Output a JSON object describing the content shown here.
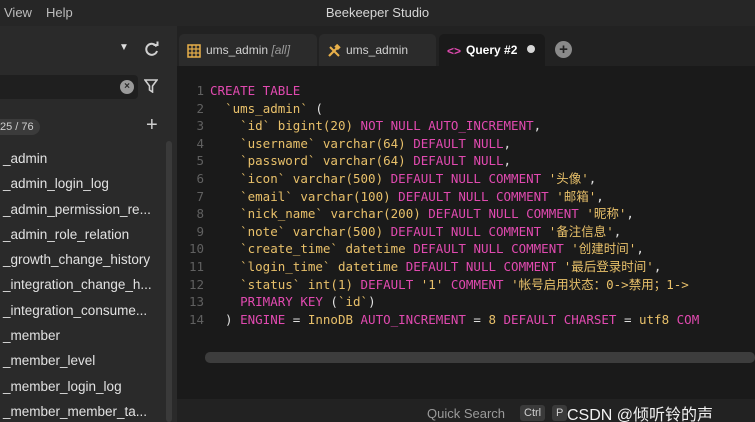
{
  "app": {
    "title": "Beekeeper Studio",
    "menu": [
      "View",
      "Help"
    ]
  },
  "sidebar": {
    "search": {
      "value": "",
      "placeholder": ""
    },
    "count": "25 / 76",
    "tables": [
      "_admin",
      "_admin_login_log",
      "_admin_permission_re...",
      "_admin_role_relation",
      "_growth_change_history",
      "_integration_change_h...",
      "_integration_consume...",
      "_member",
      "_member_level",
      "_member_login_log",
      "_member_member_ta..."
    ]
  },
  "tabs": [
    {
      "label": "ums_admin",
      "suffix": "[all]",
      "icon": "table-icon"
    },
    {
      "label": "ums_admin",
      "icon": "tools-icon"
    },
    {
      "label": "Query #2",
      "icon": "code-icon",
      "active": true
    }
  ],
  "editor": {
    "lines": [
      {
        "n": "1",
        "tokens": [
          [
            "kw",
            "CREATE TABLE"
          ]
        ]
      },
      {
        "n": "2",
        "tokens": [
          [
            "pl",
            "  "
          ],
          [
            "id",
            "`ums_admin`"
          ],
          [
            "pl",
            " ("
          ]
        ]
      },
      {
        "n": "3",
        "tokens": [
          [
            "pl",
            "    "
          ],
          [
            "id",
            "`id`"
          ],
          [
            "pl",
            " "
          ],
          [
            "ty",
            "bigint(20)"
          ],
          [
            "pl",
            " "
          ],
          [
            "kw",
            "NOT NULL AUTO_INCREMENT"
          ],
          [
            "pl",
            ","
          ]
        ]
      },
      {
        "n": "4",
        "tokens": [
          [
            "pl",
            "    "
          ],
          [
            "id",
            "`username`"
          ],
          [
            "pl",
            " "
          ],
          [
            "ty",
            "varchar(64)"
          ],
          [
            "pl",
            " "
          ],
          [
            "kw",
            "DEFAULT NULL"
          ],
          [
            "pl",
            ","
          ]
        ]
      },
      {
        "n": "5",
        "tokens": [
          [
            "pl",
            "    "
          ],
          [
            "id",
            "`password`"
          ],
          [
            "pl",
            " "
          ],
          [
            "ty",
            "varchar(64)"
          ],
          [
            "pl",
            " "
          ],
          [
            "kw",
            "DEFAULT NULL"
          ],
          [
            "pl",
            ","
          ]
        ]
      },
      {
        "n": "6",
        "tokens": [
          [
            "pl",
            "    "
          ],
          [
            "id",
            "`icon`"
          ],
          [
            "pl",
            " "
          ],
          [
            "ty",
            "varchar(500)"
          ],
          [
            "pl",
            " "
          ],
          [
            "kw",
            "DEFAULT NULL COMMENT"
          ],
          [
            "pl",
            " "
          ],
          [
            "st",
            "'头像'"
          ],
          [
            "pl",
            ","
          ]
        ]
      },
      {
        "n": "7",
        "tokens": [
          [
            "pl",
            "    "
          ],
          [
            "id",
            "`email`"
          ],
          [
            "pl",
            " "
          ],
          [
            "ty",
            "varchar(100)"
          ],
          [
            "pl",
            " "
          ],
          [
            "kw",
            "DEFAULT NULL COMMENT"
          ],
          [
            "pl",
            " "
          ],
          [
            "st",
            "'邮箱'"
          ],
          [
            "pl",
            ","
          ]
        ]
      },
      {
        "n": "8",
        "tokens": [
          [
            "pl",
            "    "
          ],
          [
            "id",
            "`nick_name`"
          ],
          [
            "pl",
            " "
          ],
          [
            "ty",
            "varchar(200)"
          ],
          [
            "pl",
            " "
          ],
          [
            "kw",
            "DEFAULT NULL COMMENT"
          ],
          [
            "pl",
            " "
          ],
          [
            "st",
            "'昵称'"
          ],
          [
            "pl",
            ","
          ]
        ]
      },
      {
        "n": "9",
        "tokens": [
          [
            "pl",
            "    "
          ],
          [
            "id",
            "`note`"
          ],
          [
            "pl",
            " "
          ],
          [
            "ty",
            "varchar(500)"
          ],
          [
            "pl",
            " "
          ],
          [
            "kw",
            "DEFAULT NULL COMMENT"
          ],
          [
            "pl",
            " "
          ],
          [
            "st",
            "'备注信息'"
          ],
          [
            "pl",
            ","
          ]
        ]
      },
      {
        "n": "10",
        "tokens": [
          [
            "pl",
            "    "
          ],
          [
            "id",
            "`create_time`"
          ],
          [
            "pl",
            " "
          ],
          [
            "ty",
            "datetime"
          ],
          [
            "pl",
            " "
          ],
          [
            "kw",
            "DEFAULT NULL COMMENT"
          ],
          [
            "pl",
            " "
          ],
          [
            "st",
            "'创建时间'"
          ],
          [
            "pl",
            ","
          ]
        ]
      },
      {
        "n": "11",
        "tokens": [
          [
            "pl",
            "    "
          ],
          [
            "id",
            "`login_time`"
          ],
          [
            "pl",
            " "
          ],
          [
            "ty",
            "datetime"
          ],
          [
            "pl",
            " "
          ],
          [
            "kw",
            "DEFAULT NULL COMMENT"
          ],
          [
            "pl",
            " "
          ],
          [
            "st",
            "'最后登录时间'"
          ],
          [
            "pl",
            ","
          ]
        ]
      },
      {
        "n": "12",
        "tokens": [
          [
            "pl",
            "    "
          ],
          [
            "id",
            "`status`"
          ],
          [
            "pl",
            " "
          ],
          [
            "ty",
            "int(1)"
          ],
          [
            "pl",
            " "
          ],
          [
            "kw",
            "DEFAULT"
          ],
          [
            "pl",
            " "
          ],
          [
            "st",
            "'1'"
          ],
          [
            "pl",
            " "
          ],
          [
            "kw",
            "COMMENT"
          ],
          [
            "pl",
            " "
          ],
          [
            "st",
            "'帐号启用状态：0->禁用；1->"
          ]
        ]
      },
      {
        "n": "13",
        "tokens": [
          [
            "pl",
            "    "
          ],
          [
            "kw",
            "PRIMARY KEY"
          ],
          [
            "pl",
            " ("
          ],
          [
            "id",
            "`id`"
          ],
          [
            "pl",
            ")"
          ]
        ]
      },
      {
        "n": "14",
        "tokens": [
          [
            "pl",
            "  ) "
          ],
          [
            "kw",
            "ENGINE"
          ],
          [
            "pl",
            " = "
          ],
          [
            "ty",
            "InnoDB"
          ],
          [
            "pl",
            " "
          ],
          [
            "kw",
            "AUTO_INCREMENT"
          ],
          [
            "pl",
            " = "
          ],
          [
            "ty",
            "8"
          ],
          [
            "pl",
            " "
          ],
          [
            "kw",
            "DEFAULT CHARSET"
          ],
          [
            "pl",
            " = "
          ],
          [
            "ty",
            "utf8"
          ],
          [
            "pl",
            " "
          ],
          [
            "kw",
            "COM"
          ]
        ]
      }
    ]
  },
  "status": {
    "quick_search": "Quick Search",
    "keys": [
      "Ctrl",
      "P"
    ],
    "watermark": "CSDN @倾听铃的声"
  }
}
